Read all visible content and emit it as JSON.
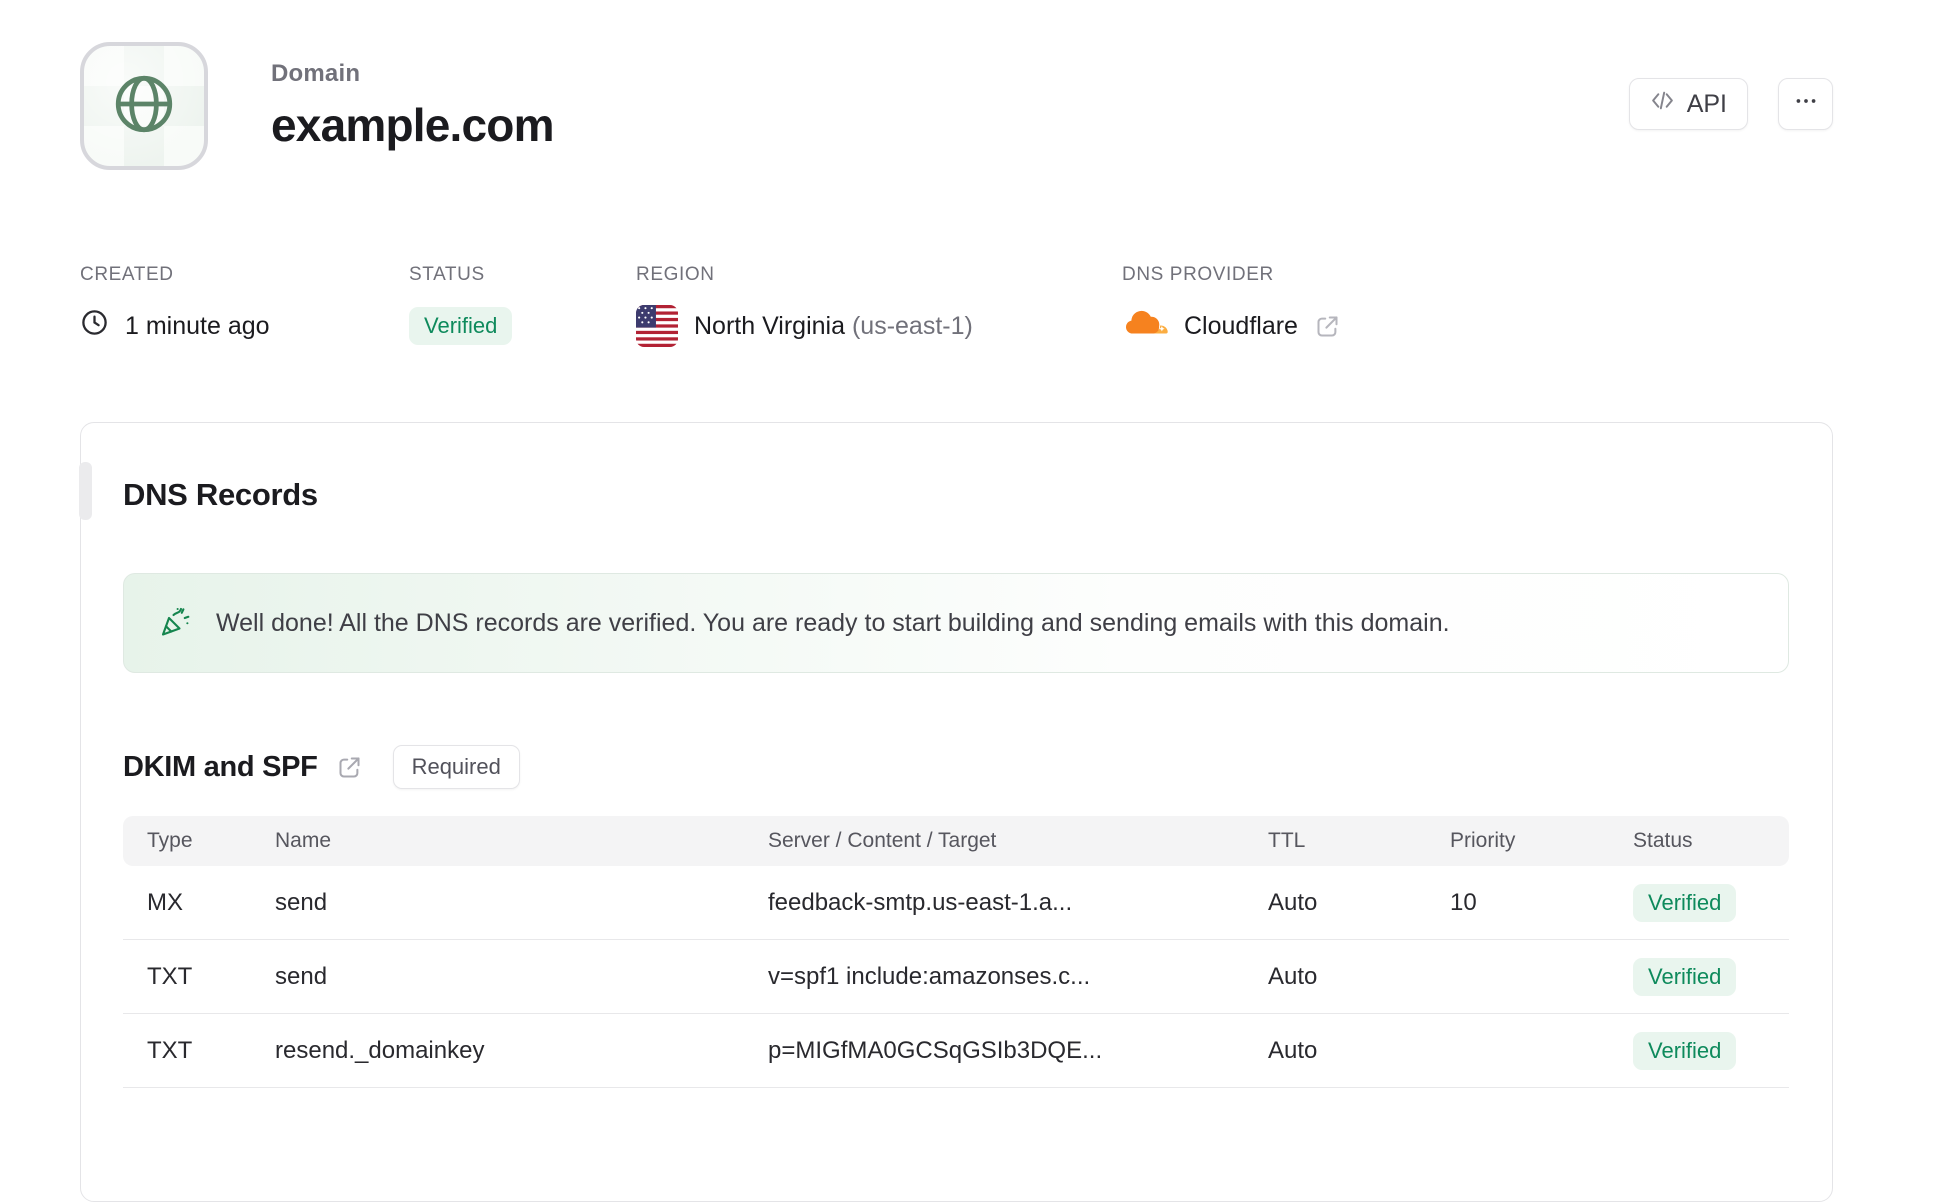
{
  "header": {
    "eyebrow": "Domain",
    "title": "example.com",
    "api_button_label": "API"
  },
  "meta": {
    "created": {
      "label": "CREATED",
      "value": "1 minute ago"
    },
    "status": {
      "label": "STATUS",
      "value": "Verified"
    },
    "region": {
      "label": "REGION",
      "name": "North Virginia",
      "code": "(us-east-1)"
    },
    "dns_provider": {
      "label": "DNS PROVIDER",
      "value": "Cloudflare"
    }
  },
  "dns_records": {
    "title": "DNS Records",
    "banner_text": "Well done! All the DNS records are verified. You are ready to start building and sending emails with this domain.",
    "section": {
      "title": "DKIM and SPF",
      "badge": "Required"
    },
    "table": {
      "headers": [
        "Type",
        "Name",
        "Server / Content / Target",
        "TTL",
        "Priority",
        "Status"
      ],
      "rows": [
        {
          "type": "MX",
          "name": "send",
          "content": "feedback-smtp.us-east-1.a...",
          "ttl": "Auto",
          "priority": "10",
          "status": "Verified"
        },
        {
          "type": "TXT",
          "name": "send",
          "content": "v=spf1 include:amazonses.c...",
          "ttl": "Auto",
          "priority": "",
          "status": "Verified"
        },
        {
          "type": "TXT",
          "name": "resend._domainkey",
          "content": "p=MIGfMA0GCSqGSIb3DQE...",
          "ttl": "Auto",
          "priority": "",
          "status": "Verified"
        }
      ]
    }
  },
  "icons": {
    "avatar": "globe-icon",
    "created": "clock-icon",
    "region": "us-flag-icon",
    "dns_provider": "cloudflare-icon",
    "api": "code-icon",
    "more": "ellipsis-icon",
    "banner": "party-popper-icon",
    "external": "external-link-icon"
  },
  "colors": {
    "verified-text": "#0e8a5c",
    "verified-bg": "#e9f5ee",
    "cloudflare-orange": "#f6821f",
    "banner-green": "#e7f3ea",
    "globe-green": "#5c8468"
  }
}
